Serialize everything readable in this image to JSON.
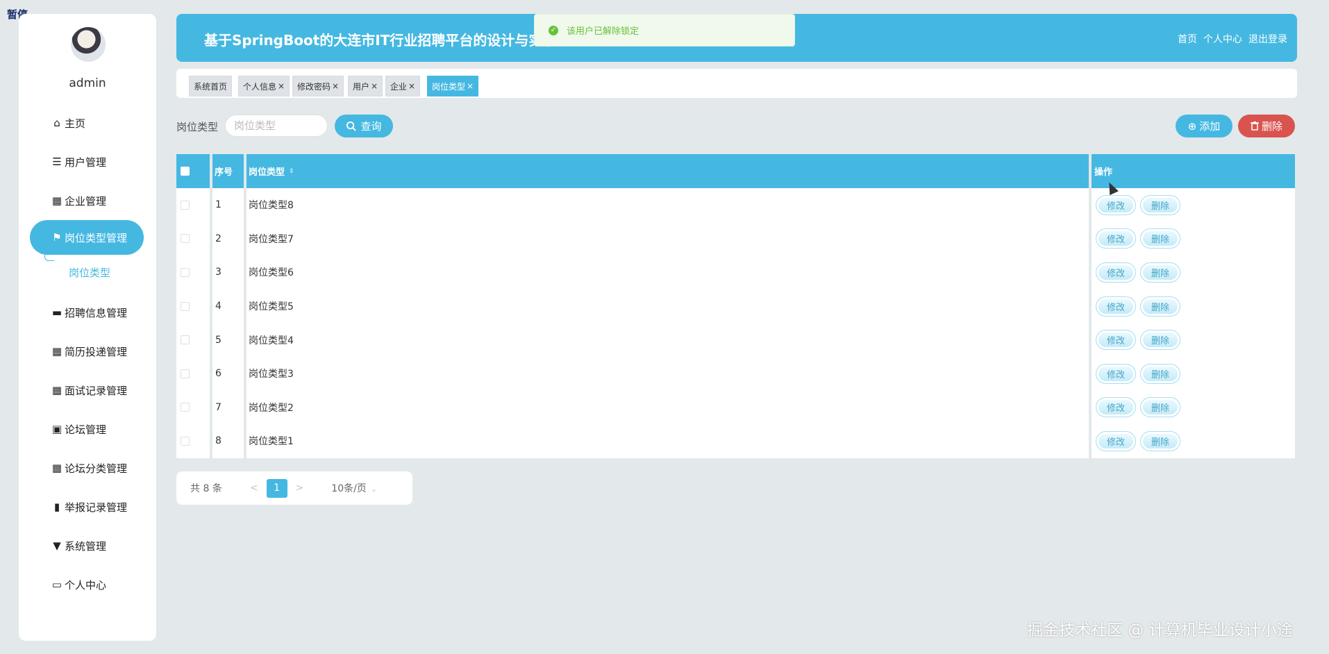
{
  "overlay": {
    "pause": "暂停",
    "watermark": "掘金技术社区 @ 计算机毕业设计小途"
  },
  "sidebar": {
    "username": "admin",
    "items": [
      {
        "label": "主页",
        "icon": "home-icon"
      },
      {
        "label": "用户管理",
        "icon": "list-icon"
      },
      {
        "label": "企业管理",
        "icon": "grid-icon"
      },
      {
        "label": "岗位类型管理",
        "icon": "flag-icon",
        "active": true
      },
      {
        "label": "招聘信息管理",
        "icon": "ticket-icon"
      },
      {
        "label": "简历投递管理",
        "icon": "grid-icon"
      },
      {
        "label": "面试记录管理",
        "icon": "grid-icon"
      },
      {
        "label": "论坛管理",
        "icon": "briefcase-icon"
      },
      {
        "label": "论坛分类管理",
        "icon": "grid-icon"
      },
      {
        "label": "举报记录管理",
        "icon": "chart-icon"
      },
      {
        "label": "系统管理",
        "icon": "pin-icon"
      },
      {
        "label": "个人中心",
        "icon": "card-icon"
      }
    ],
    "sub_item": "岗位类型"
  },
  "header": {
    "title": "基于SpringBoot的大连市IT行业招聘平台的设计与实现",
    "nav": [
      "首页",
      "个人中心",
      "退出登录"
    ]
  },
  "toast": {
    "message": "该用户已解除锁定",
    "color": "#67c23a"
  },
  "tabs": [
    {
      "label": "系统首页",
      "closable": false
    },
    {
      "label": "个人信息",
      "closable": true
    },
    {
      "label": "修改密码",
      "closable": true
    },
    {
      "label": "用户",
      "closable": true
    },
    {
      "label": "企业",
      "closable": true
    },
    {
      "label": "岗位类型",
      "closable": true,
      "active": true
    }
  ],
  "search": {
    "label": "岗位类型",
    "placeholder": "岗位类型",
    "query_button": "查询"
  },
  "actions": {
    "add": "添加",
    "delete": "删除"
  },
  "table": {
    "headers": {
      "index": "序号",
      "type": "岗位类型",
      "ops": "操作"
    },
    "rows": [
      {
        "index": "1",
        "type": "岗位类型8"
      },
      {
        "index": "2",
        "type": "岗位类型7"
      },
      {
        "index": "3",
        "type": "岗位类型6"
      },
      {
        "index": "4",
        "type": "岗位类型5"
      },
      {
        "index": "5",
        "type": "岗位类型4"
      },
      {
        "index": "6",
        "type": "岗位类型3"
      },
      {
        "index": "7",
        "type": "岗位类型2"
      },
      {
        "index": "8",
        "type": "岗位类型1"
      }
    ],
    "edit_label": "修改",
    "delete_label": "删除"
  },
  "pagination": {
    "total": "共 8 条",
    "current": "1",
    "prev": "<",
    "next": ">",
    "page_size": "10条/页"
  },
  "colors": {
    "accent": "#45b8e2",
    "danger": "#d9534f",
    "background": "#e3e8ea"
  }
}
